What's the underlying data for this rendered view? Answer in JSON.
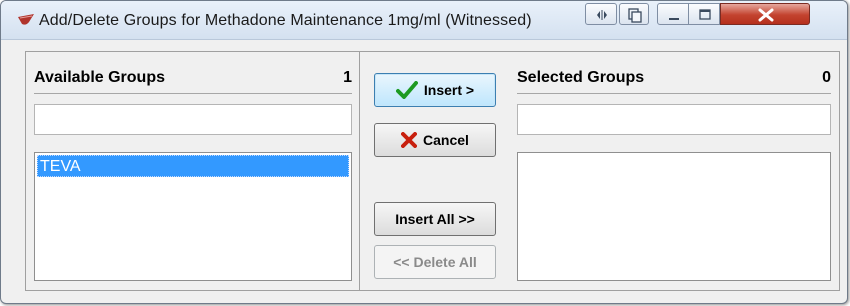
{
  "window": {
    "title": "Add/Delete Groups for Methadone Maintenance 1mg/ml (Witnessed)"
  },
  "title_buttons": {
    "arrows_icon": "left-right-arrows-icon",
    "restore_icon": "copy-window-icon",
    "minimize_icon": "minimize-icon",
    "maximize_icon": "maximize-icon",
    "close_icon": "close-icon",
    "close_color": "#c3432f"
  },
  "available": {
    "title": "Available Groups",
    "count": "1",
    "search_value": "",
    "items": [
      "TEVA"
    ],
    "selected_color": "#3399ff"
  },
  "selected": {
    "title": "Selected Groups",
    "count": "0",
    "search_value": "",
    "items": []
  },
  "actions": {
    "insert_label": "Insert >",
    "cancel_label": "Cancel",
    "insert_all_label": "Insert All >>",
    "delete_all_label": "<< Delete All",
    "insert_icon": "checkmark-icon",
    "cancel_icon": "x-icon"
  }
}
